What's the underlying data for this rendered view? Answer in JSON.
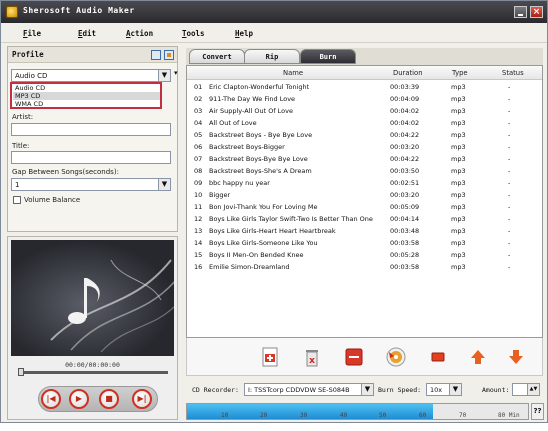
{
  "window": {
    "title": "Sherosoft Audio Maker",
    "close_label": "×"
  },
  "menu": {
    "items": [
      {
        "label": "File",
        "key": "F"
      },
      {
        "label": "Edit",
        "key": "E"
      },
      {
        "label": "Action",
        "key": "A"
      },
      {
        "label": "Tools",
        "key": "T"
      },
      {
        "label": "Help",
        "key": "H"
      }
    ]
  },
  "profile": {
    "heading": "Profile",
    "selected": "Audio CD",
    "options": [
      "Audio CD",
      "MP3 CD",
      "WMA CD"
    ],
    "artist_label": "Artist:",
    "title_label": "Title:",
    "gap_label": "Gap Between Songs(seconds):",
    "gap_value": "1",
    "volume_label": "Volume Balance",
    "volume_checked": false
  },
  "player": {
    "time": "00:00/00:00:00",
    "progress": 0
  },
  "tabs": [
    {
      "label": "Convert",
      "active": false
    },
    {
      "label": "Rip",
      "active": false
    },
    {
      "label": "Burn",
      "active": true
    }
  ],
  "tracklist": {
    "columns": [
      "Name",
      "Duration",
      "Type",
      "Status"
    ],
    "rows": [
      {
        "no": "01",
        "name": "Eric Clapton-Wonderful Tonight",
        "duration": "00:03:39",
        "type": "mp3",
        "status": "-"
      },
      {
        "no": "02",
        "name": "911-The Day We Find Love",
        "duration": "00:04:09",
        "type": "mp3",
        "status": "-"
      },
      {
        "no": "03",
        "name": "Air Supply-All Out Of Love",
        "duration": "00:04:02",
        "type": "mp3",
        "status": "-"
      },
      {
        "no": "04",
        "name": "All Out of Love",
        "duration": "00:04:02",
        "type": "mp3",
        "status": "-"
      },
      {
        "no": "05",
        "name": "Backstreet Boys - Bye Bye Love",
        "duration": "00:04:22",
        "type": "mp3",
        "status": "-"
      },
      {
        "no": "06",
        "name": "Backstreet Boys-Bigger",
        "duration": "00:03:20",
        "type": "mp3",
        "status": "-"
      },
      {
        "no": "07",
        "name": "Backstreet Boys-Bye Bye Love",
        "duration": "00:04:22",
        "type": "mp3",
        "status": "-"
      },
      {
        "no": "08",
        "name": "Backstreet Boys-She's A Dream",
        "duration": "00:03:50",
        "type": "mp3",
        "status": "-"
      },
      {
        "no": "09",
        "name": "bbc happy nu year",
        "duration": "00:02:51",
        "type": "mp3",
        "status": "-"
      },
      {
        "no": "10",
        "name": "Bigger",
        "duration": "00:03:20",
        "type": "mp3",
        "status": "-"
      },
      {
        "no": "11",
        "name": "Bon Jovi-Thank You For Loving Me",
        "duration": "00:05:09",
        "type": "mp3",
        "status": "-"
      },
      {
        "no": "12",
        "name": "Boys Like Girls Taylor Swift-Two Is Better Than One",
        "duration": "00:04:14",
        "type": "mp3",
        "status": "-"
      },
      {
        "no": "13",
        "name": "Boys Like Girls-Heart Heart Heartbreak",
        "duration": "00:03:48",
        "type": "mp3",
        "status": "-"
      },
      {
        "no": "14",
        "name": "Boys Like Girls-Someone Like You",
        "duration": "00:03:58",
        "type": "mp3",
        "status": "-"
      },
      {
        "no": "15",
        "name": "Boys II Men-On Bended Knee",
        "duration": "00:05:28",
        "type": "mp3",
        "status": "-"
      },
      {
        "no": "16",
        "name": "Emilie Simon-Dreamland",
        "duration": "00:03:58",
        "type": "mp3",
        "status": "-"
      }
    ]
  },
  "recorder": {
    "cd_recorder_label": "CD Recorder:",
    "cd_recorder_value": "I: TSSTcorp CDDVDW SE-S084B",
    "burn_speed_label": "Burn Speed:",
    "burn_speed_value": "10x",
    "amount_label": "Amount:",
    "amount_value": "1"
  },
  "capacity": {
    "ticks": [
      "10",
      "20",
      "30",
      "40",
      "50",
      "60",
      "70",
      "80 Min"
    ],
    "fill_fraction": 0.72,
    "help_label": "??"
  },
  "colors": {
    "accent_red": "#c03040",
    "capacity_blue": "#1e8cd6"
  }
}
